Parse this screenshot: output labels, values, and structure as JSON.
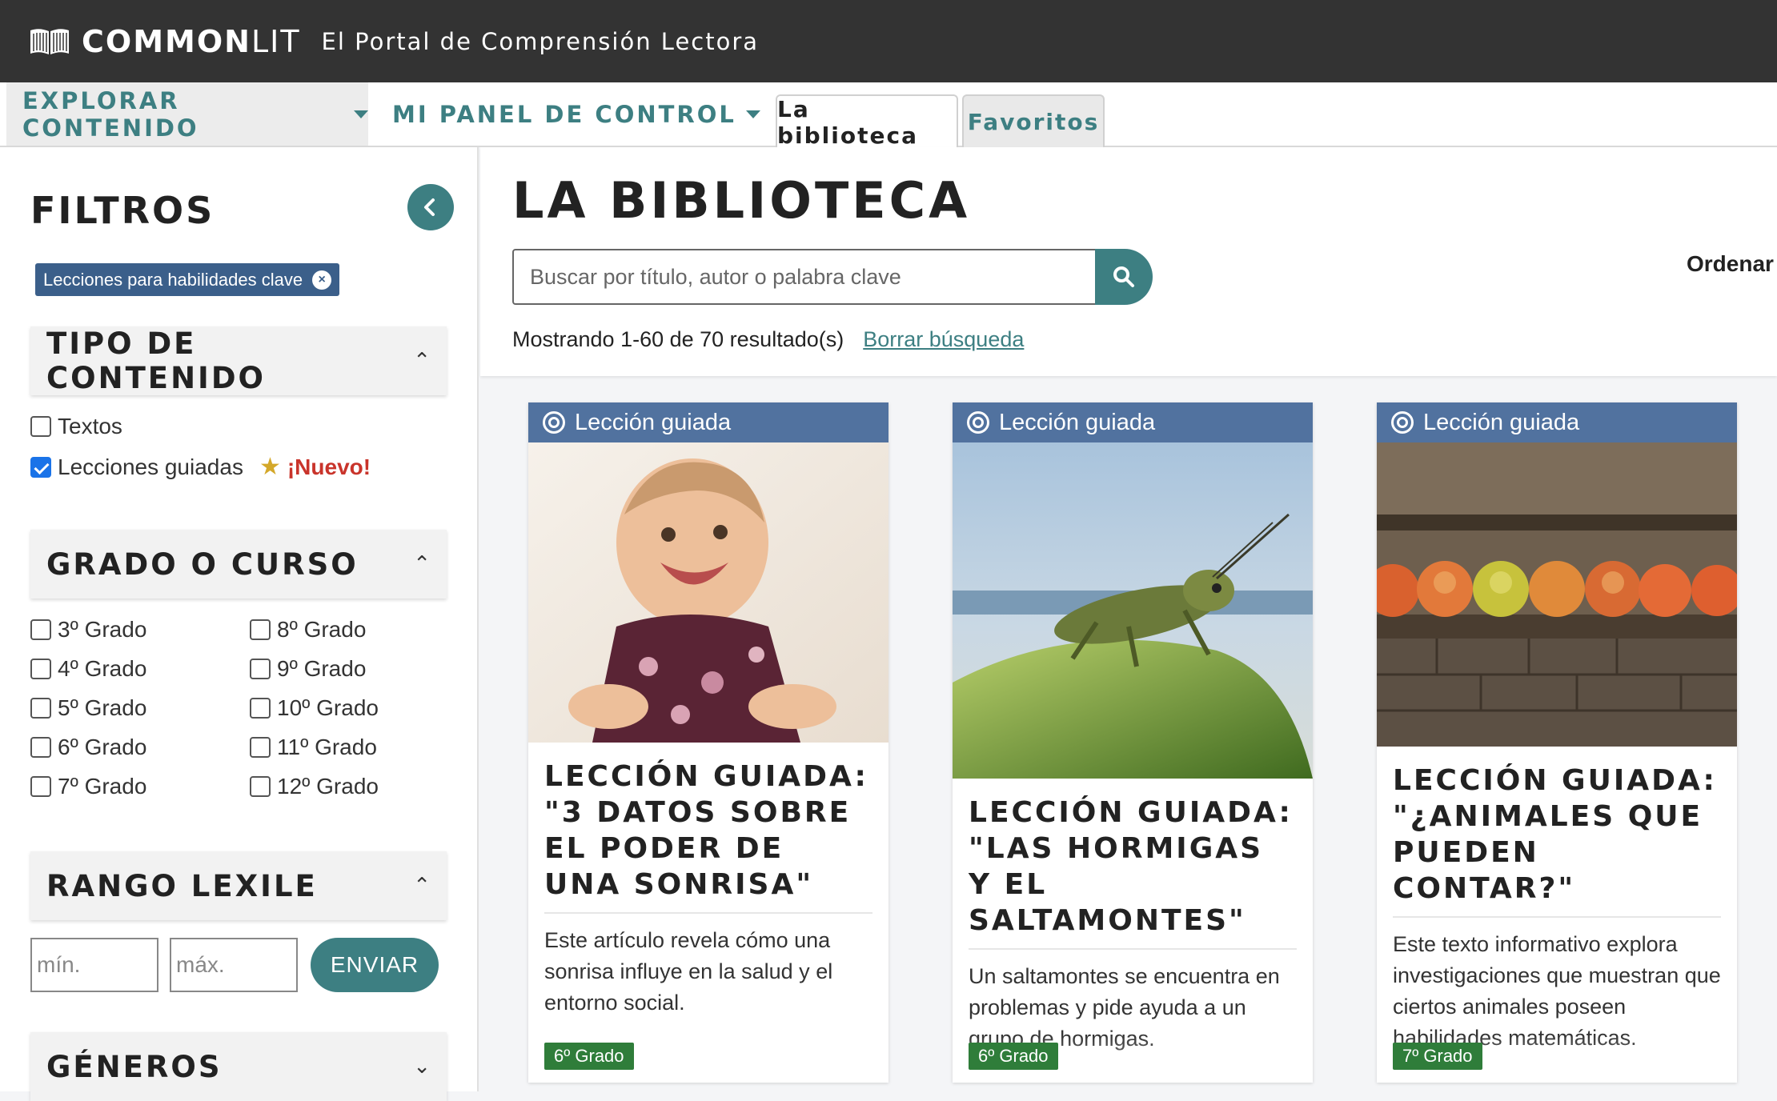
{
  "header": {
    "brand_bold": "COMMON",
    "brand_light": "LIT",
    "tagline": "El Portal de Comprensión Lectora"
  },
  "nav": {
    "explorar": "EXPLORAR CONTENIDO",
    "panel": "MI PANEL DE CONTROL",
    "tab_biblioteca": "La biblioteca",
    "tab_favoritos": "Favoritos"
  },
  "sidebar": {
    "title": "FILTROS",
    "active_chip": "Lecciones para habilidades clave",
    "tipo": {
      "heading": "TIPO DE CONTENIDO",
      "options": [
        {
          "label": "Textos",
          "checked": false
        },
        {
          "label": "Lecciones guiadas",
          "checked": true
        }
      ],
      "nuevo": "¡Nuevo!"
    },
    "grado": {
      "heading": "GRADO O CURSO",
      "left": [
        "3º Grado",
        "4º Grado",
        "5º Grado",
        "6º Grado",
        "7º Grado"
      ],
      "right": [
        "8º Grado",
        "9º Grado",
        "10º Grado",
        "11º Grado",
        "12º Grado"
      ]
    },
    "lexile": {
      "heading": "RANGO LEXILE",
      "min_placeholder": "mín.",
      "max_placeholder": "máx.",
      "submit": "ENVIAR"
    },
    "generos": {
      "heading": "GÉNEROS"
    }
  },
  "main": {
    "title": "LA BIBLIOTECA",
    "search_placeholder": "Buscar por título, autor o palabra clave",
    "sort_label": "Ordenar",
    "results_text": "Mostrando 1-60 de 70 resultado(s)",
    "clear_link": "Borrar búsqueda",
    "cards": [
      {
        "tag": "Lección guiada",
        "title": "LECCIÓN GUIADA: \"3 DATOS SOBRE EL PODER DE UNA SONRISA\"",
        "desc": "Este artículo revela cómo una sonrisa influye en la salud y el entorno social.",
        "grade": "6º Grado"
      },
      {
        "tag": "Lección guiada",
        "title": "LECCIÓN GUIADA: \"LAS HORMIGAS Y EL SALTAMONTES\"",
        "desc": "Un saltamontes se encuentra en problemas y pide ayuda a un grupo de hormigas.",
        "grade": "6º Grado"
      },
      {
        "tag": "Lección guiada",
        "title": "LECCIÓN GUIADA: \"¿ANIMALES QUE PUEDEN CONTAR?\"",
        "desc": "Este texto informativo explora investigaciones que muestran que ciertos animales poseen habilidades matemáticas.",
        "grade": "7º Grado"
      }
    ]
  },
  "colors": {
    "topbar": "#333333",
    "teal": "#3d7f82",
    "tag_blue": "#51729f",
    "grade_green": "#2f7d3a",
    "nuevo_red": "#c9342b"
  }
}
